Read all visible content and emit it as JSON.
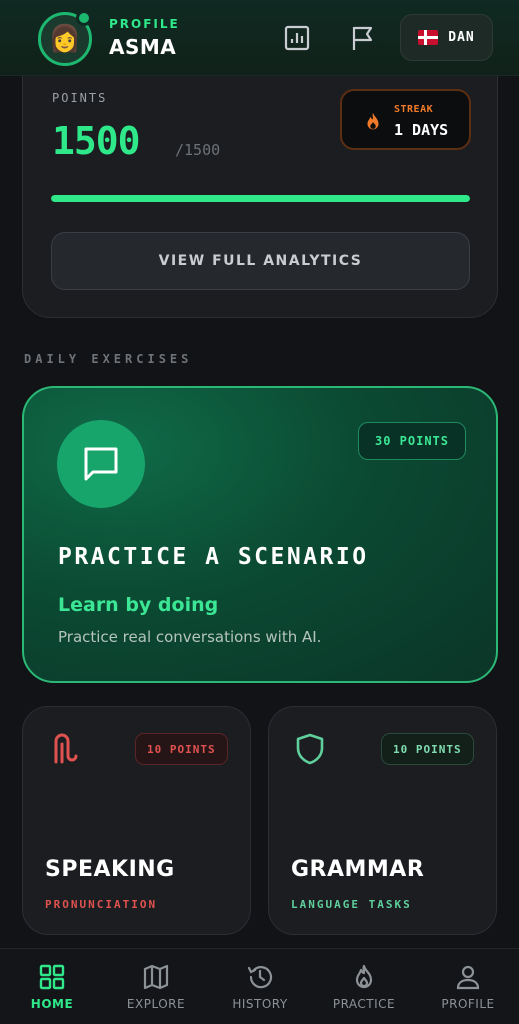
{
  "header": {
    "profile_label": "PROFILE",
    "user_name": "ASMA",
    "avatar_emoji": "👩",
    "language_code": "DAN",
    "icons": [
      "stats-icon",
      "flag-icon",
      "denmark-flag-icon"
    ]
  },
  "points_card": {
    "label": "POINTS",
    "value": "1500",
    "total": "/1500",
    "progress_fraction": 1.0,
    "streak_label": "STREAK",
    "streak_value": "1 DAYS",
    "analytics_button": "VIEW FULL ANALYTICS"
  },
  "daily": {
    "section_title": "DAILY EXERCISES",
    "scenario": {
      "points": "30 POINTS",
      "title": "PRACTICE A SCENARIO",
      "subtitle": "Learn by doing",
      "description": "Practice real conversations with AI.",
      "icon": "chat-bubble-icon"
    },
    "speaking": {
      "points": "10 POINTS",
      "title": "SPEAKING",
      "subtitle": "PRONUNCIATION",
      "icon": "ear-icon"
    },
    "grammar": {
      "points": "10 POINTS",
      "title": "GRAMMAR",
      "subtitle": "LANGUAGE TASKS",
      "icon": "shield-icon"
    }
  },
  "nav": {
    "items": [
      {
        "label": "HOME",
        "icon": "home-grid-icon",
        "active": true
      },
      {
        "label": "EXPLORE",
        "icon": "map-icon",
        "active": false
      },
      {
        "label": "HISTORY",
        "icon": "history-icon",
        "active": false
      },
      {
        "label": "PRACTICE",
        "icon": "flame-icon",
        "active": false
      },
      {
        "label": "PROFILE",
        "icon": "user-icon",
        "active": false
      }
    ]
  },
  "colors": {
    "accent": "#2ee88a",
    "streak": "#f07a2a",
    "speaking": "#e0524f",
    "grammar": "#5fcf9c"
  }
}
